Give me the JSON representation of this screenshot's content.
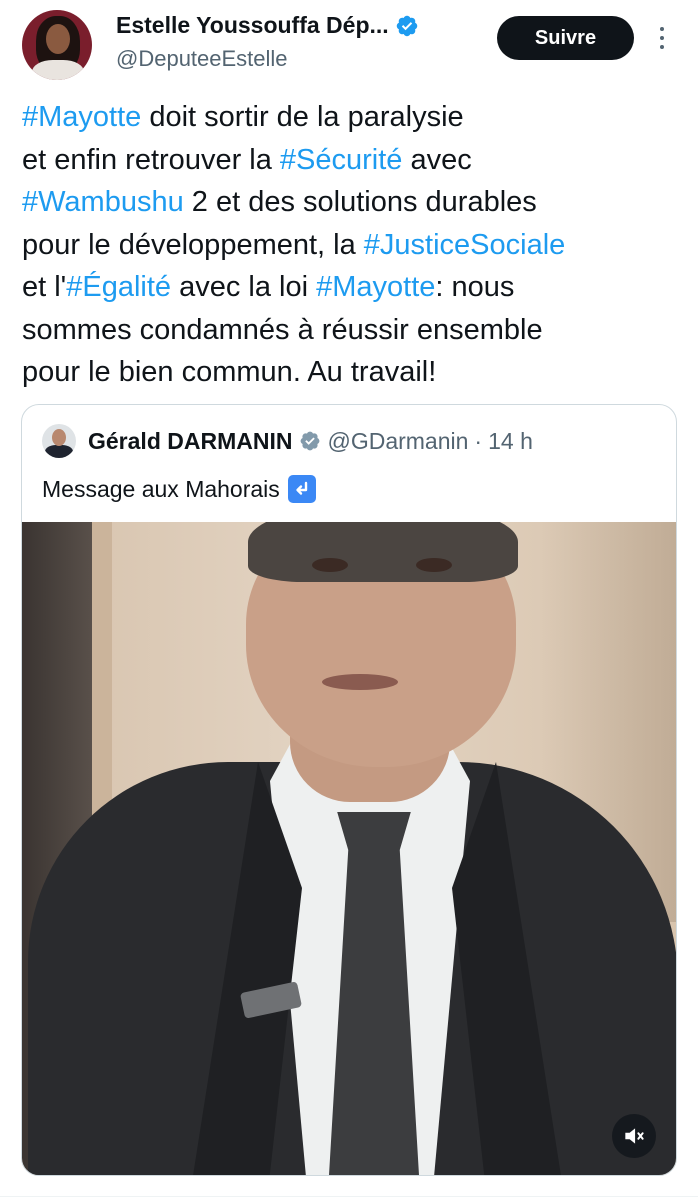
{
  "author": {
    "display_name": "Estelle Youssouffa Dép...",
    "handle": "@DeputeeEstelle",
    "verified": true
  },
  "actions": {
    "follow_label": "Suivre"
  },
  "tweet": {
    "lines": [
      [
        {
          "t": "#Mayotte",
          "tag": true
        },
        {
          "t": " doit sortir de la paralysie",
          "tag": false
        }
      ],
      [
        {
          "t": "et enfin retrouver la ",
          "tag": false
        },
        {
          "t": "#Sécurité",
          "tag": true
        },
        {
          "t": " avec",
          "tag": false
        }
      ],
      [
        {
          "t": "#Wambushu",
          "tag": true
        },
        {
          "t": " 2 et des solutions durables",
          "tag": false
        }
      ],
      [
        {
          "t": "pour le développement, la ",
          "tag": false
        },
        {
          "t": "#JusticeSociale",
          "tag": true
        }
      ],
      [
        {
          "t": "et l'",
          "tag": false
        },
        {
          "t": "#Égalité",
          "tag": true
        },
        {
          "t": " avec la loi ",
          "tag": false
        },
        {
          "t": "#Mayotte",
          "tag": true
        },
        {
          "t": ": nous",
          "tag": false
        }
      ],
      [
        {
          "t": "sommes condamnés à réussir ensemble",
          "tag": false
        }
      ],
      [
        {
          "t": "pour le bien commun. Au travail!",
          "tag": false
        }
      ]
    ]
  },
  "quote": {
    "display_name": "Gérald DARMANIN",
    "handle": "@GDarmanin",
    "separator": "·",
    "time": "14 h",
    "text": "Message aux Mahorais",
    "emoji": "arrow-down-left-icon"
  },
  "colors": {
    "link": "#1d9bf0",
    "text": "#0f1419",
    "secondary": "#536471",
    "follow_bg": "#0f1419",
    "verified": "#1d9bf0",
    "border": "#cfd9de"
  }
}
